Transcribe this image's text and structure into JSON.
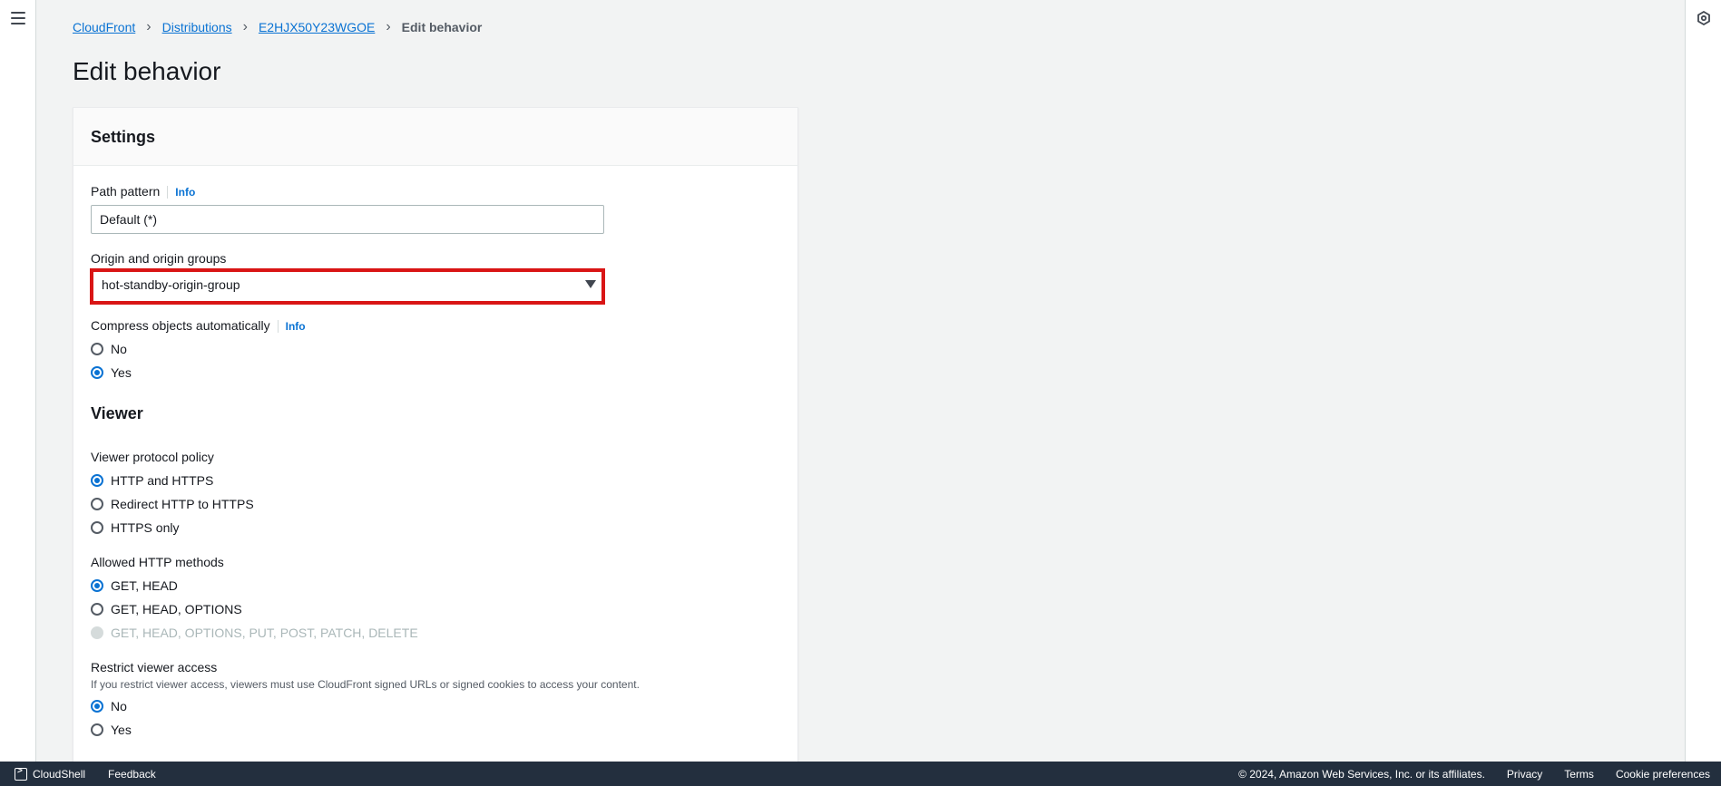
{
  "breadcrumb": {
    "items": [
      "CloudFront",
      "Distributions",
      "E2HJX50Y23WGOE"
    ],
    "current": "Edit behavior"
  },
  "page": {
    "title": "Edit behavior"
  },
  "settings": {
    "header": "Settings",
    "path_pattern": {
      "label": "Path pattern",
      "info": "Info",
      "value": "Default (*)"
    },
    "origin": {
      "label": "Origin and origin groups",
      "value": "hot-standby-origin-group"
    },
    "compress": {
      "label": "Compress objects automatically",
      "info": "Info",
      "options": [
        "No",
        "Yes"
      ],
      "selected": "Yes"
    }
  },
  "viewer": {
    "title": "Viewer",
    "protocol": {
      "label": "Viewer protocol policy",
      "options": [
        "HTTP and HTTPS",
        "Redirect HTTP to HTTPS",
        "HTTPS only"
      ],
      "selected": "HTTP and HTTPS"
    },
    "methods": {
      "label": "Allowed HTTP methods",
      "options": [
        "GET, HEAD",
        "GET, HEAD, OPTIONS",
        "GET, HEAD, OPTIONS, PUT, POST, PATCH, DELETE"
      ],
      "selected": "GET, HEAD",
      "disabled": "GET, HEAD, OPTIONS, PUT, POST, PATCH, DELETE"
    },
    "restrict": {
      "label": "Restrict viewer access",
      "description": "If you restrict viewer access, viewers must use CloudFront signed URLs or signed cookies to access your content.",
      "options": [
        "No",
        "Yes"
      ],
      "selected": "No"
    }
  },
  "footer": {
    "cloudshell": "CloudShell",
    "feedback": "Feedback",
    "copyright": "© 2024, Amazon Web Services, Inc. or its affiliates.",
    "privacy": "Privacy",
    "terms": "Terms",
    "cookies": "Cookie preferences"
  },
  "colors": {
    "accent": "#0972d3",
    "highlight": "#d91515",
    "footer_bg": "#232f3e"
  }
}
